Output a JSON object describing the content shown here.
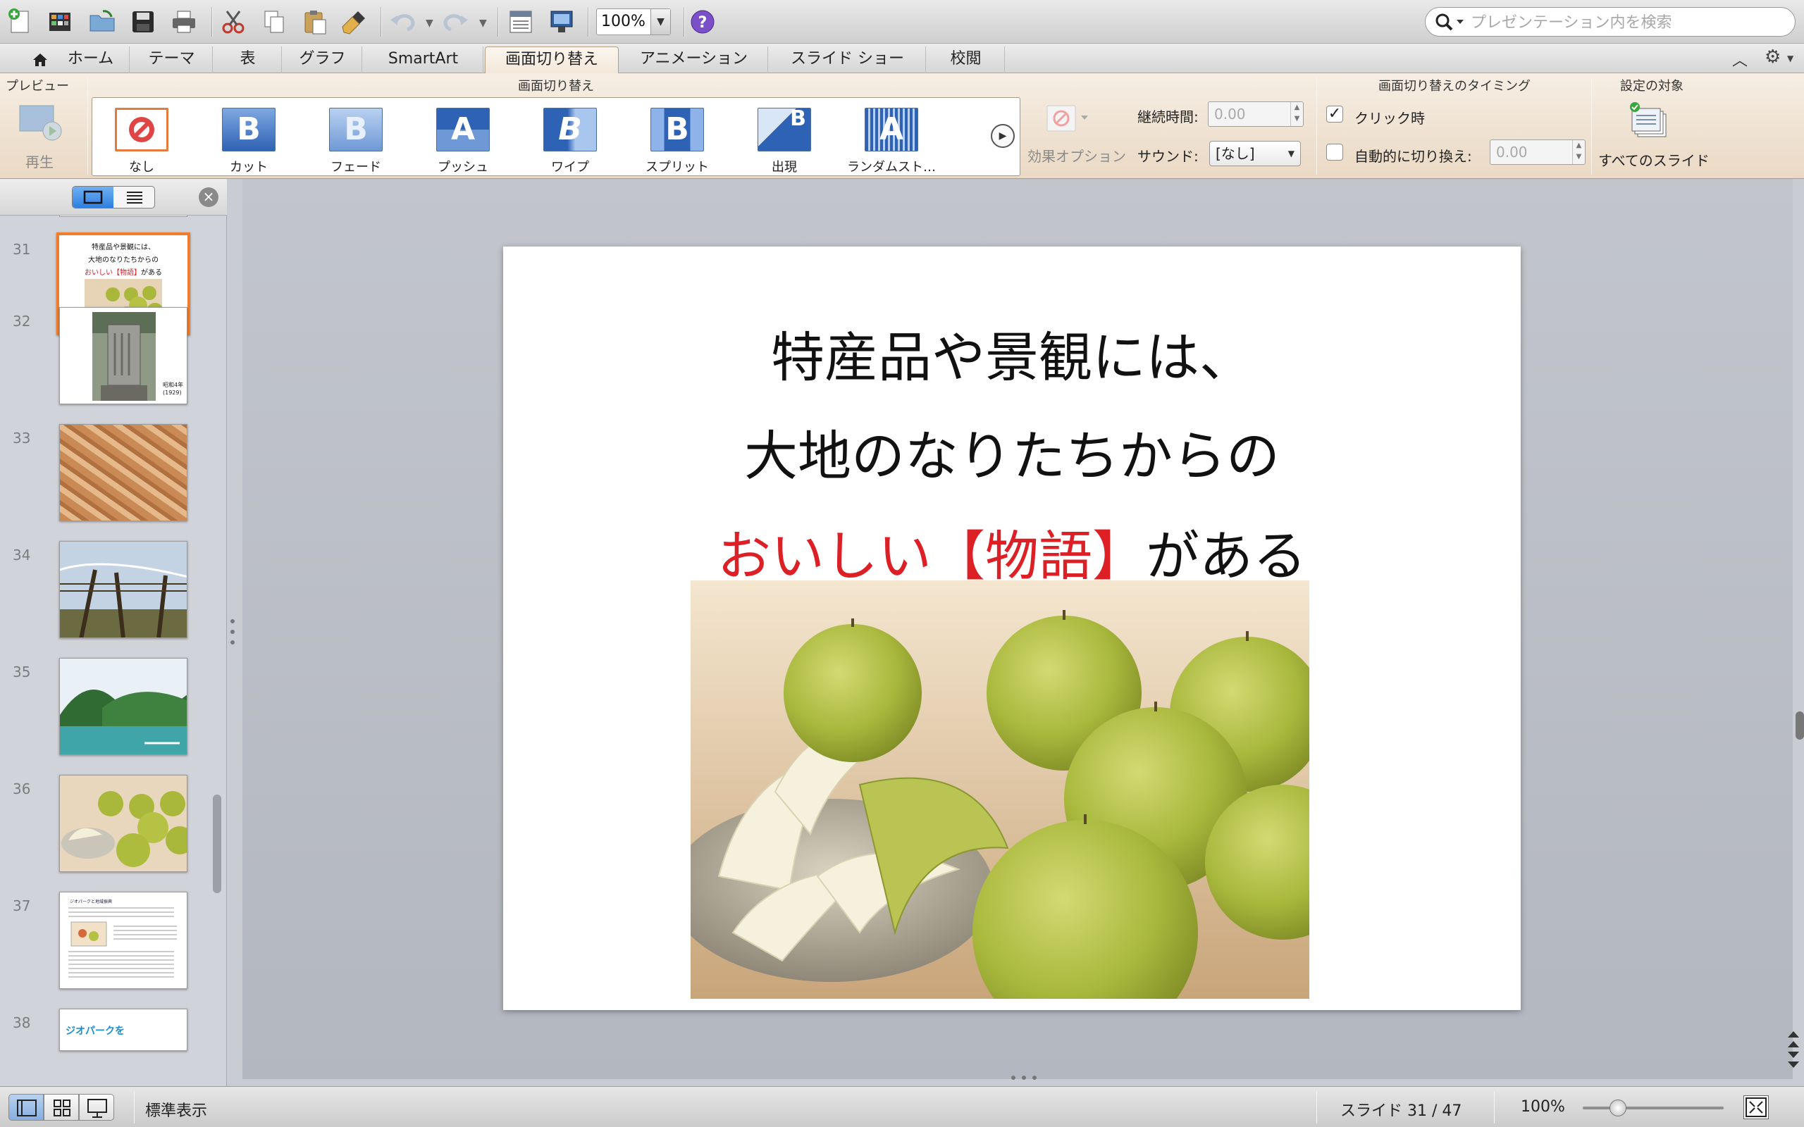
{
  "toolbar": {
    "zoom_value": "100%",
    "search_placeholder": "プレゼンテーション内を検索"
  },
  "tabs": [
    {
      "label": "ホーム"
    },
    {
      "label": "テーマ"
    },
    {
      "label": "表"
    },
    {
      "label": "グラフ"
    },
    {
      "label": "SmartArt"
    },
    {
      "label": "画面切り替え"
    },
    {
      "label": "アニメーション"
    },
    {
      "label": "スライド ショー"
    },
    {
      "label": "校閲"
    }
  ],
  "ribbon": {
    "preview_group": "プレビュー",
    "play_label": "再生",
    "transitions_group": "画面切り替え",
    "transitions": [
      {
        "label": "なし",
        "glyph": ""
      },
      {
        "label": "カット",
        "glyph": "B"
      },
      {
        "label": "フェード",
        "glyph": "B"
      },
      {
        "label": "プッシュ",
        "glyph": "A"
      },
      {
        "label": "ワイプ",
        "glyph": "B"
      },
      {
        "label": "スプリット",
        "glyph": "B"
      },
      {
        "label": "出現",
        "glyph": "B"
      },
      {
        "label": "ランダムスト…",
        "glyph": "A"
      }
    ],
    "effect_options": "効果オプション",
    "duration_label": "継続時間:",
    "duration_value": "0.00",
    "sound_label": "サウンド:",
    "sound_value": "[なし]",
    "timing_group": "画面切り替えのタイミング",
    "on_click_label": "クリック時",
    "auto_advance_label": "自動的に切り換え:",
    "auto_advance_value": "0.00",
    "apply_group": "設定の対象",
    "apply_all_label": "すべてのスライド"
  },
  "sidebar": {
    "slides": [
      {
        "number": "31",
        "t1": "特産品や景観には、",
        "t2": "大地のなりたちからの",
        "t3r": "おいしい【物語】",
        "t3": "がある"
      },
      {
        "number": "32",
        "caption1": "昭和4年",
        "caption2": "(1929)"
      },
      {
        "number": "33"
      },
      {
        "number": "34"
      },
      {
        "number": "35"
      },
      {
        "number": "36"
      },
      {
        "number": "37",
        "heading": "ジオパークと地域振興"
      },
      {
        "number": "38",
        "heading": "ジオパークを"
      }
    ]
  },
  "slide": {
    "line1": "特産品や景観には、",
    "line2": "大地のなりたちからの",
    "line3_red": "おいしい【物語】",
    "line3_black": "がある"
  },
  "status": {
    "view_name": "標準表示",
    "slide_label": "スライド 31 / 47",
    "zoom": "100%",
    "zoom_level_percent": 100
  },
  "colors": {
    "accent_orange": "#f07c2c",
    "title_red": "#dd1f26",
    "ribbon_bg": "#f3e7d9"
  }
}
